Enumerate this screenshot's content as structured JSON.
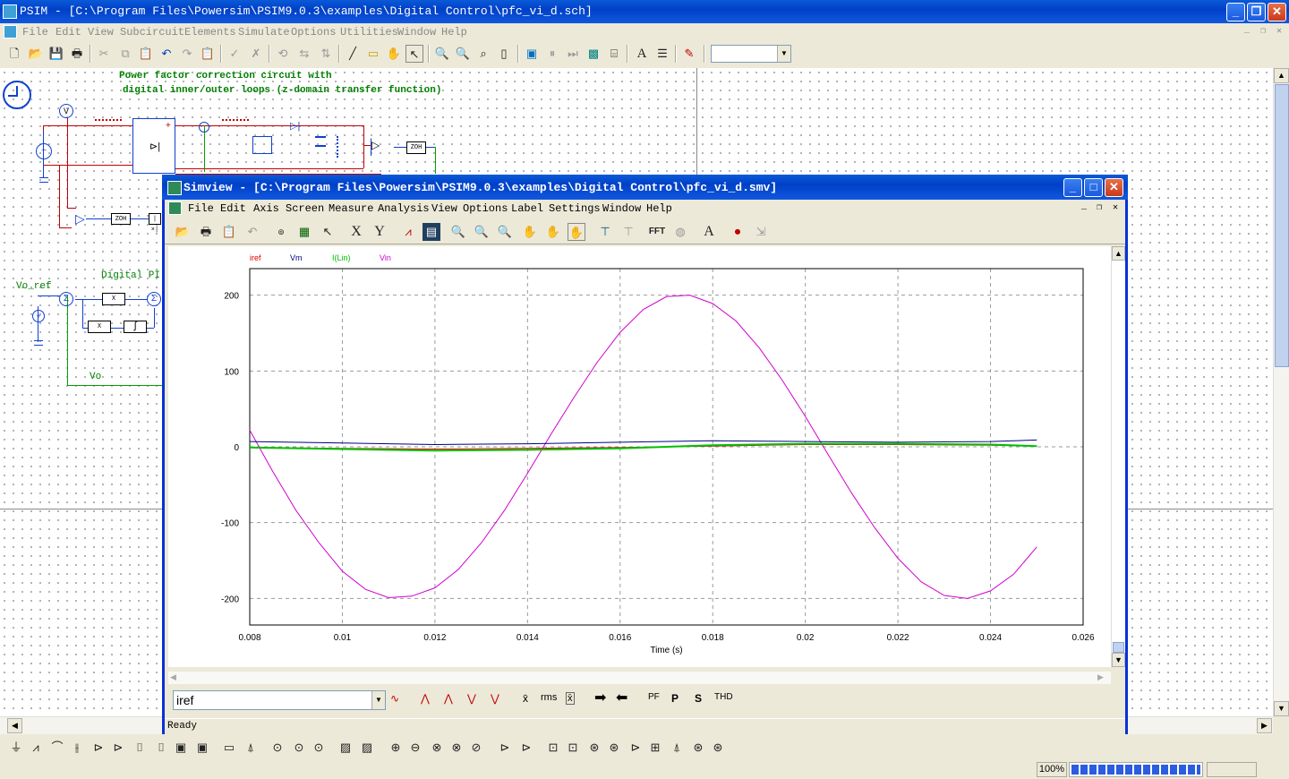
{
  "main": {
    "title": "PSIM - [C:\\Program Files\\Powersim\\PSIM9.0.3\\examples\\Digital Control\\pfc_vi_d.sch]",
    "menu": [
      "File",
      "Edit",
      "View",
      "Subcircuit",
      "Elements",
      "Simulate",
      "Options",
      "Utilities",
      "Window",
      "Help"
    ],
    "zoom": "100%",
    "toolbar_combo": ""
  },
  "schematic": {
    "title_line1": "Power factor correction circuit with",
    "title_line2": "digital inner/outer loops (z-domain transfer function)",
    "digital_pi_label": "Digital PI",
    "vo_ref_label": "Vo_ref",
    "vo_label": "Vo",
    "v_meter": "V",
    "zoh1": "ZOH",
    "zoh2": "ZOH",
    "limiter": "|×|",
    "mult1": "X",
    "mult2": "X",
    "integrator": "∫"
  },
  "simview": {
    "title": "Simview - [C:\\Program Files\\Powersim\\PSIM9.0.3\\examples\\Digital Control\\pfc_vi_d.smv]",
    "menu": [
      "File",
      "Edit",
      "Axis",
      "Screen",
      "Measure",
      "Analysis",
      "View",
      "Options",
      "Label",
      "Settings",
      "Window",
      "Help"
    ],
    "toolbar_text": {
      "x": "X",
      "y": "Y",
      "fft": "FFT",
      "a": "A"
    },
    "variable_select": "iref",
    "measure_buttons": [
      "rms",
      "PF",
      "P",
      "S",
      "THD"
    ],
    "status": "Ready"
  },
  "chart_data": {
    "type": "line",
    "title": "",
    "xlabel": "Time (s)",
    "ylabel": "",
    "xlim": [
      0.008,
      0.026
    ],
    "ylim": [
      -235,
      235
    ],
    "xticks": [
      0.008,
      0.01,
      0.012,
      0.014,
      0.016,
      0.018,
      0.02,
      0.022,
      0.024,
      0.026
    ],
    "xtick_labels": [
      "0.008",
      "0.01",
      "0.012",
      "0.014",
      "0.016",
      "0.018",
      "0.02",
      "0.022",
      "0.024",
      "0.026"
    ],
    "yticks": [
      200,
      100,
      0,
      -100,
      -200
    ],
    "ytick_labels": [
      "200",
      "100",
      "0",
      "-100",
      "-200"
    ],
    "grid": true,
    "legend_placement": "top-left",
    "series": [
      {
        "name": "iref",
        "color": "#e00000",
        "x": [
          0.008,
          0.01,
          0.012,
          0.014,
          0.016,
          0.018,
          0.02,
          0.022,
          0.024,
          0.025
        ],
        "y": [
          -1,
          -2,
          -3,
          -2,
          -1,
          1,
          3,
          3,
          2,
          1
        ]
      },
      {
        "name": "Vm",
        "color": "#000080",
        "x": [
          0.008,
          0.01,
          0.012,
          0.014,
          0.016,
          0.018,
          0.02,
          0.022,
          0.024,
          0.025
        ],
        "y": [
          7,
          5,
          3,
          4,
          6,
          8,
          7,
          6,
          7,
          9
        ]
      },
      {
        "name": "I(Lin)",
        "color": "#00c000",
        "x": [
          0.008,
          0.01,
          0.012,
          0.014,
          0.016,
          0.018,
          0.02,
          0.022,
          0.024,
          0.025
        ],
        "y": [
          -1,
          -3,
          -5,
          -4,
          -2,
          2,
          4,
          4,
          3,
          1
        ]
      },
      {
        "name": "Vin",
        "color": "#d000d0",
        "x": [
          0.008,
          0.0085,
          0.009,
          0.0095,
          0.01,
          0.0105,
          0.011,
          0.0115,
          0.012,
          0.0125,
          0.013,
          0.0135,
          0.014,
          0.0145,
          0.015,
          0.0155,
          0.016,
          0.0165,
          0.017,
          0.0175,
          0.018,
          0.0185,
          0.019,
          0.0195,
          0.02,
          0.0205,
          0.021,
          0.0215,
          0.022,
          0.0225,
          0.023,
          0.0235,
          0.024,
          0.0245,
          0.025
        ],
        "y": [
          22,
          -33,
          -84,
          -127,
          -164,
          -188,
          -199,
          -197,
          -186,
          -162,
          -127,
          -84,
          -35,
          16,
          65,
          111,
          151,
          181,
          198,
          200,
          189,
          166,
          131,
          88,
          40,
          -11,
          -61,
          -107,
          -147,
          -178,
          -196,
          -200,
          -190,
          -168,
          -132
        ]
      }
    ]
  },
  "colors": {
    "titlebar": "#0a5ad8",
    "wire_red": "#c00000",
    "wire_green": "#00a000",
    "wire_blue": "#1040d0",
    "grid": "#9a9a9a"
  }
}
